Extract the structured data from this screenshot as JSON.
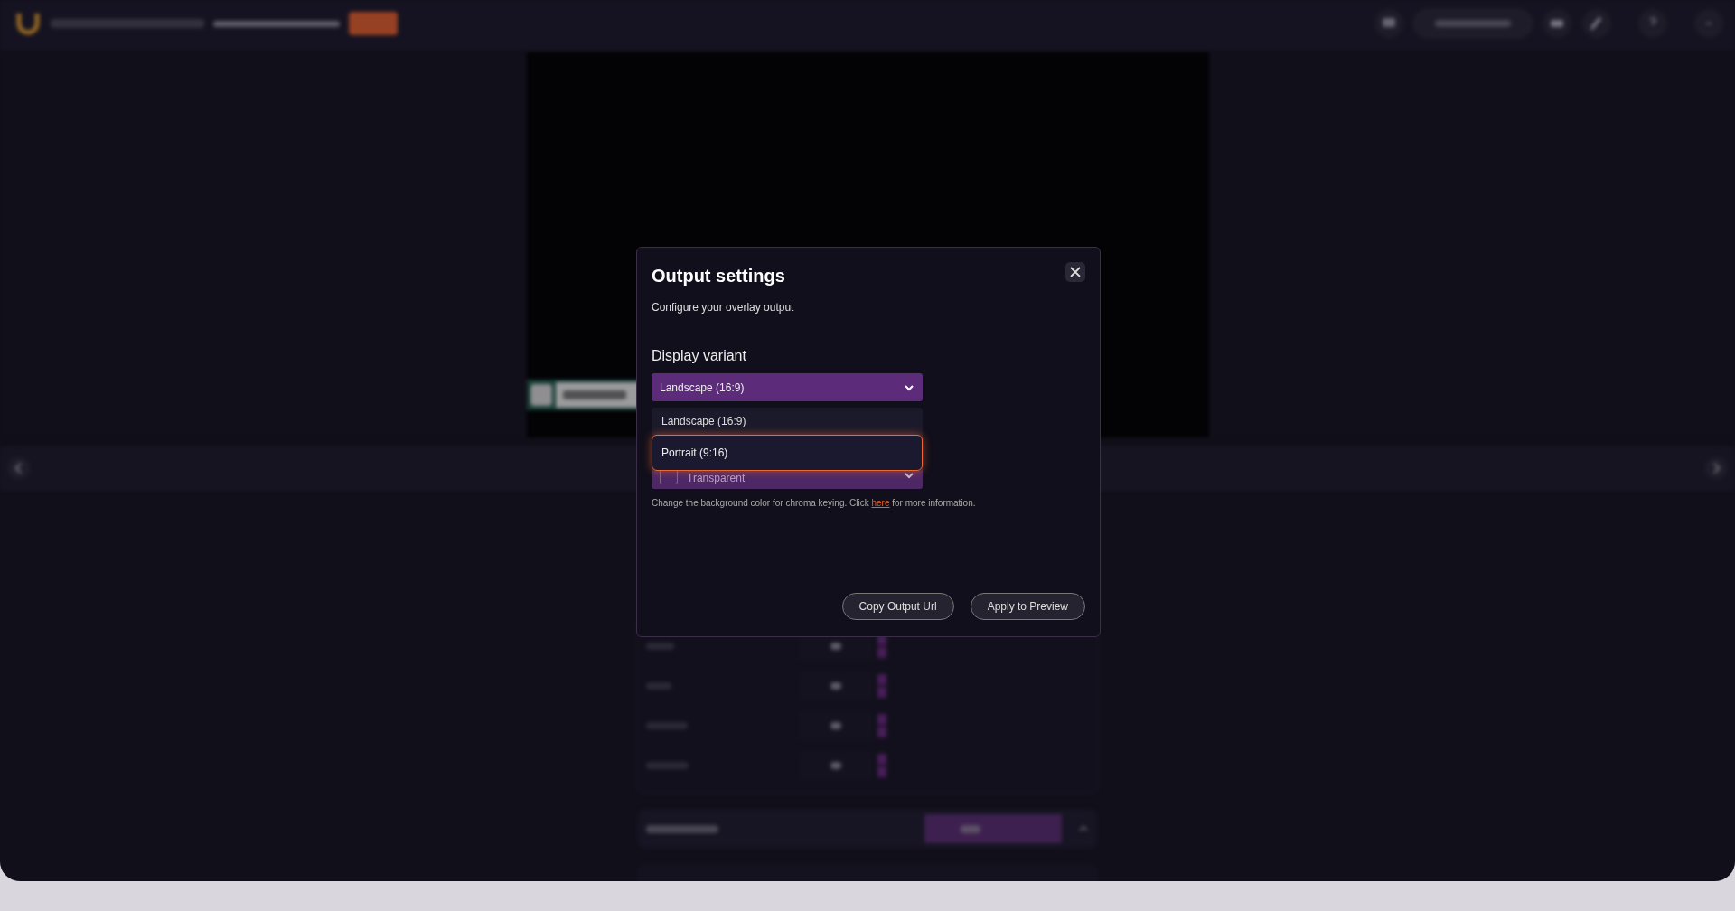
{
  "dialog": {
    "title": "Output settings",
    "subtitle": "Configure your overlay output",
    "display_variant": {
      "label": "Display variant",
      "value": "Landscape (16:9)",
      "options": [
        {
          "label": "Landscape (16:9)",
          "highlighted": false
        },
        {
          "label": "Portrait (9:16)",
          "highlighted": true
        }
      ]
    },
    "background": {
      "value": "Transparent"
    },
    "help_before": "Change the background color for chroma keying. Click",
    "help_link": "here",
    "help_after": "for more information.",
    "buttons": [
      "Copy Output Url",
      "Apply to Preview"
    ]
  }
}
